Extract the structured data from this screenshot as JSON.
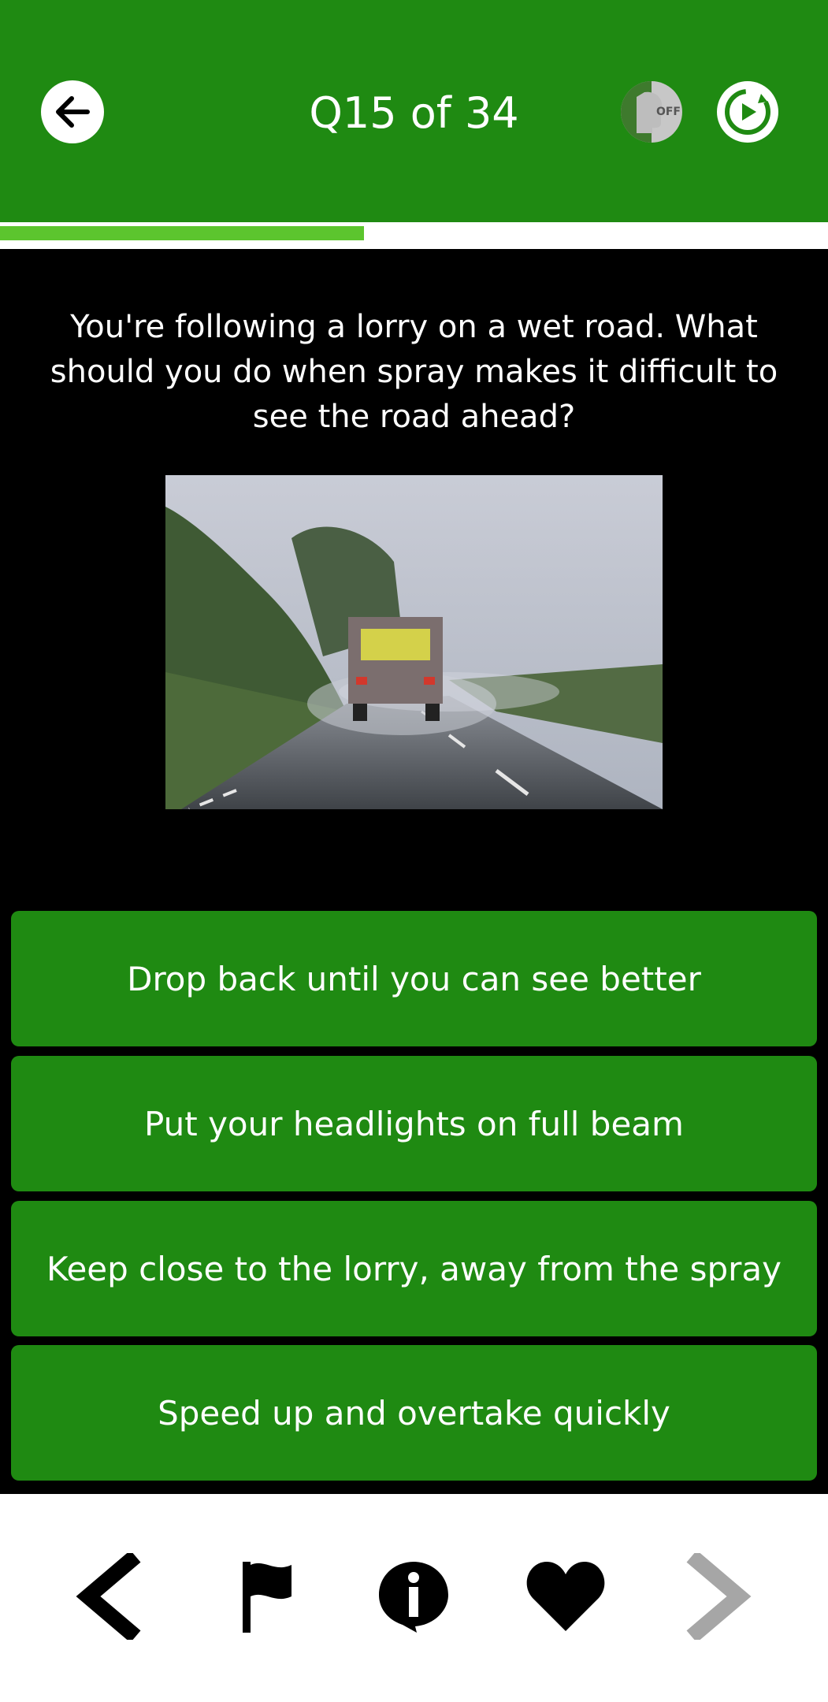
{
  "header": {
    "title": "Q15 of 34",
    "voice_toggle_label": "OFF",
    "icons": {
      "back": "arrow-left-icon",
      "voice": "voice-off-icon",
      "refresh": "refresh-icon"
    }
  },
  "progress": {
    "value": 15,
    "total": 34,
    "fraction": 0.44
  },
  "question": {
    "text": "You're following a lorry on a wet road. What should you do when spray makes it difficult to see the road ahead?"
  },
  "answers": [
    {
      "label": "Drop back until you can see better"
    },
    {
      "label": "Put your headlights on full beam"
    },
    {
      "label": "Keep close to the lorry, away from the spray"
    },
    {
      "label": "Speed up and overtake quickly"
    }
  ],
  "bottom_nav": {
    "icons": [
      "chevron-left-icon",
      "flag-icon",
      "info-icon",
      "heart-icon",
      "chevron-right-icon"
    ]
  },
  "colors": {
    "header_green": "#1f8a12",
    "answer_green": "#1f8a12",
    "progress_green": "#5cc52e",
    "background": "#000000",
    "disabled_gray": "#a6a6a6"
  }
}
